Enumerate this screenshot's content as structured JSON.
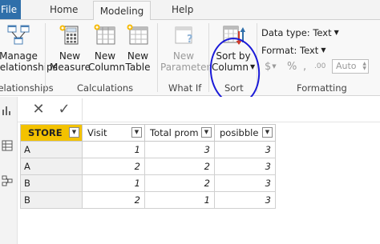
{
  "tabs": {
    "file": "File",
    "home": "Home",
    "modeling": "Modeling",
    "help": "Help"
  },
  "ribbon": {
    "manage_relationships": {
      "line1": "Manage",
      "line2": "Relationships",
      "group": "Relationships"
    },
    "new_measure": {
      "line1": "New",
      "line2": "Measure"
    },
    "new_column": {
      "line1": "New",
      "line2": "Column"
    },
    "new_table": {
      "line1": "New",
      "line2": "Table"
    },
    "calculations_group": "Calculations",
    "new_parameter": {
      "line1": "New",
      "line2": "Parameter"
    },
    "whatif_group": "What If",
    "sort_by_column": {
      "line1": "Sort by",
      "line2": "Column"
    },
    "sort_group": "Sort",
    "data_type": "Data type: Text",
    "format": "Format: Text",
    "currency_symbol": "$",
    "percent_symbol": "%",
    "comma_symbol": ",",
    "decimal_symbol": ".00",
    "auto_value": "Auto",
    "formatting_group": "Formatting"
  },
  "formula_bar": {
    "cancel": "✕",
    "commit": "✓"
  },
  "table": {
    "columns": [
      "STORE",
      "Visit",
      "Total prom",
      "posibble"
    ],
    "rows": [
      [
        "A",
        "1",
        "3",
        "3"
      ],
      [
        "A",
        "2",
        "2",
        "3"
      ],
      [
        "B",
        "1",
        "2",
        "3"
      ],
      [
        "B",
        "2",
        "1",
        "3"
      ]
    ]
  },
  "colors": {
    "file_tab": "#2f6faa",
    "selected_column_header": "#f3c200",
    "annotation_circle": "#1a1ad8"
  }
}
